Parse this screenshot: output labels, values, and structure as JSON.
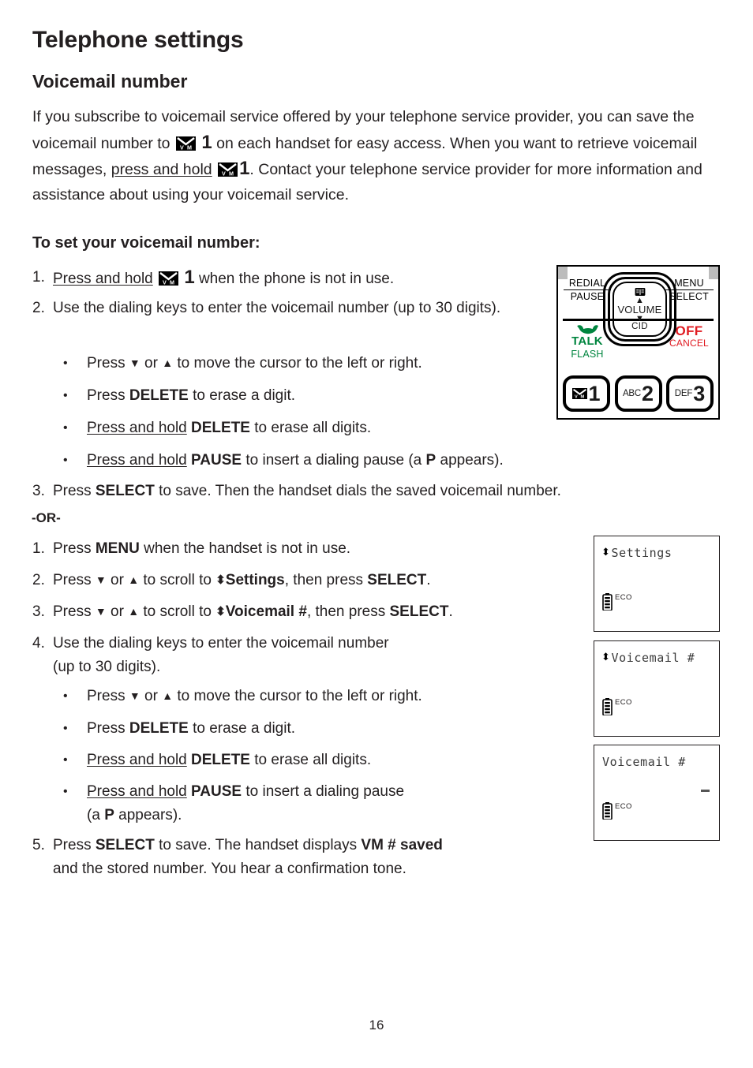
{
  "document": {
    "chapter_title": "Telephone settings",
    "section_title": "Voicemail number",
    "page_number": "16"
  },
  "intro": {
    "part1": "If you subscribe to voicemail service offered by your telephone service provider, you can save the voicemail number to",
    "key_digit": "1",
    "part2": "on each handset for easy access. When you want to retrieve voicemail messages,",
    "press_hold": "press and hold",
    "part3": ". Contact your telephone service provider for more information and assistance about using your voicemail service."
  },
  "procedure_a": {
    "heading": "To set your voicemail number:",
    "step1": {
      "num": "1.",
      "press_hold": "Press and hold",
      "digit": "1",
      "rest": "when the phone is not in use."
    },
    "step2": {
      "num": "2.",
      "text": "Use the dialing keys to enter the voicemail number (up to 30 digits)."
    },
    "bullets": [
      {
        "pre": "Press",
        "arrow_down": "▼",
        "mid": "or",
        "arrow_up": "▲",
        "post": "to move the cursor to the left or right."
      },
      {
        "pre": "Press",
        "key": "DELETE",
        "post": "to erase a digit."
      },
      {
        "underlined": "Press and hold",
        "key": "DELETE",
        "post": "to erase all digits."
      },
      {
        "underlined": "Press and hold",
        "key": "PAUSE",
        "post": "to insert a dialing pause (a",
        "bold_p": "P",
        "tail": "appears)."
      }
    ],
    "step3": {
      "num": "3.",
      "pre": "Press",
      "key": "SELECT",
      "post": "to save. Then the handset dials the saved voicemail number."
    }
  },
  "or_label": "-OR-",
  "procedure_b": {
    "step1": {
      "num": "1.",
      "pre": "Press",
      "key": "MENU",
      "post": "when the handset is not in use."
    },
    "step2": {
      "num": "2.",
      "pre": "Press",
      "arrow_down": "▼",
      "mid": "or",
      "arrow_up": "▲",
      "to": "to scroll to",
      "updown": "⬍",
      "menu_item": "Settings",
      "comma": ", then press",
      "key": "SELECT",
      "period": "."
    },
    "step3": {
      "num": "3.",
      "pre": "Press",
      "arrow_down": "▼",
      "mid": "or",
      "arrow_up": "▲",
      "to": "to scroll to",
      "updown": "⬍",
      "menu_item": "Voicemail #",
      "comma": ", then press",
      "key": "SELECT",
      "period": "."
    },
    "step4": {
      "num": "4.",
      "line1": "Use the dialing keys to enter the voicemail number",
      "line2": "(up to 30 digits)."
    },
    "bullets": [
      {
        "pre": "Press",
        "arrow_down": "▼",
        "mid": "or",
        "arrow_up": "▲",
        "post": "to move the cursor to the left or right."
      },
      {
        "pre": "Press",
        "key": "DELETE",
        "post": "to erase a digit."
      },
      {
        "underlined": "Press and hold",
        "key": "DELETE",
        "post": "to erase all digits."
      },
      {
        "underlined": "Press and hold",
        "key": "PAUSE",
        "post": "to insert a dialing pause",
        "line2_pre": "(a",
        "bold_p": "P",
        "line2_post": "appears)."
      }
    ],
    "step5": {
      "num": "5.",
      "pre": "Press",
      "key": "SELECT",
      "mid": "to save. The handset displays",
      "result": "VM # saved",
      "post": "and the stored number. You hear a confirmation tone."
    }
  },
  "phone_figure": {
    "redial": "REDIAL",
    "pause": "PAUSE",
    "menu": "MENU",
    "select": "SELECT",
    "talk": "TALK",
    "flash": "FLASH",
    "off": "OFF",
    "cancel": "CANCEL",
    "volume": "VOLUME",
    "cid": "CID",
    "up_arrow": "▲",
    "down_arrow": "▼",
    "keys": [
      {
        "sub": "",
        "digit": "1",
        "icon": "envelope-vm-icon"
      },
      {
        "sub": "ABC",
        "digit": "2",
        "icon": ""
      },
      {
        "sub": "DEF",
        "digit": "3",
        "icon": ""
      }
    ],
    "colors": {
      "talk_green": "#00853f",
      "off_red": "#e01b22",
      "frame_black": "#000000"
    }
  },
  "lcd_screens": [
    {
      "updown": "⬍",
      "text": "Settings",
      "eco": "ECO",
      "cursor": false
    },
    {
      "updown": "⬍",
      "text": "Voicemail #",
      "eco": "ECO",
      "cursor": false
    },
    {
      "updown": "",
      "text": "Voicemail #",
      "eco": "ECO",
      "cursor": true
    }
  ]
}
